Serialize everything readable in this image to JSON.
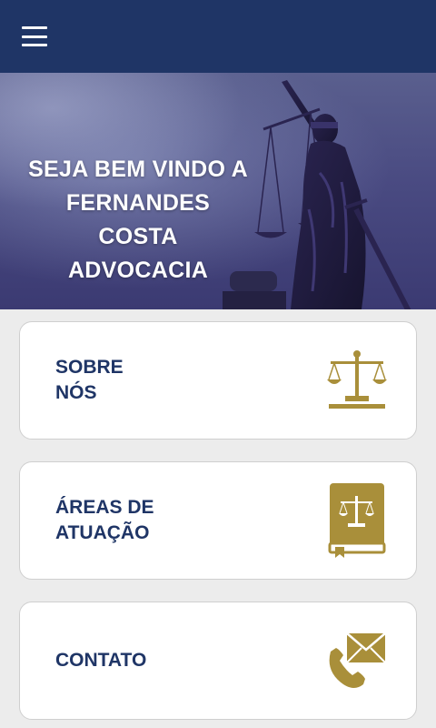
{
  "header": {
    "menu_icon": "hamburger-menu-icon"
  },
  "hero": {
    "title_lines": [
      "SEJA BEM VINDO A",
      "FERNANDES",
      "COSTA",
      "ADVOCACIA"
    ]
  },
  "cards": [
    {
      "label_lines": [
        "SOBRE",
        "NÓS"
      ],
      "icon": "scales-of-justice-icon"
    },
    {
      "label_lines": [
        "ÁREAS DE",
        "ATUAÇÃO"
      ],
      "icon": "law-book-icon"
    },
    {
      "label_lines": [
        "CONTATO"
      ],
      "icon": "phone-envelope-icon"
    }
  ],
  "colors": {
    "header_bg": "#1f3566",
    "accent_gold": "#a98f3a",
    "text_navy": "#1f3566",
    "page_bg": "#ececec"
  }
}
